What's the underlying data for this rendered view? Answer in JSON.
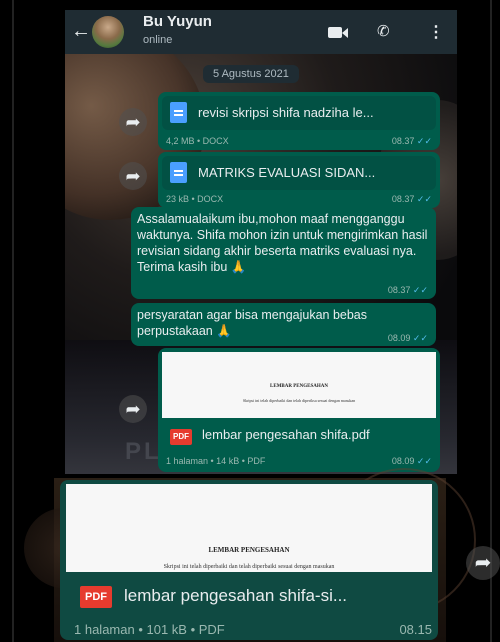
{
  "header": {
    "contact_name": "Bu Yuyun",
    "status": "online",
    "back_glyph": "←",
    "call_glyph": "✆",
    "menu_glyph": "⋮"
  },
  "date_separator": "5 Agustus 2021",
  "messages": [
    {
      "type": "document",
      "filename": "revisi skripsi shifa nadziha le...",
      "meta": "4,2 MB • DOCX",
      "time": "08.37",
      "ticks": "✓✓"
    },
    {
      "type": "document",
      "filename": "MATRIKS EVALUASI SIDAN...",
      "meta": "23 kB • DOCX",
      "time": "08.37",
      "ticks": "✓✓"
    },
    {
      "type": "text",
      "text": "Assalamualaikum ibu,mohon maaf mengganggu waktunya. Shifa mohon izin untuk mengirimkan hasil revisian sidang akhir beserta matriks evaluasi nya. Terima kasih ibu 🙏",
      "time": "08.37",
      "ticks": "✓✓"
    },
    {
      "type": "text",
      "text": "persyaratan agar bisa mengajukan bebas perpustakaan 🙏",
      "time": "08.09",
      "ticks": "✓✓"
    },
    {
      "type": "pdf",
      "preview_title": "LEMBAR PENGESAHAN",
      "preview_text": "Skripsi ini telah diperbaiki dan telah diperiksa sesuai dengan masukan",
      "badge": "PDF",
      "filename": "lembar pengesahan shifa.pdf",
      "meta": "1 halaman • 14 kB • PDF",
      "time": "08.09",
      "ticks": "✓✓"
    }
  ],
  "background_text": "PL",
  "bottom_message": {
    "preview_title": "LEMBAR PENGESAHAN",
    "preview_text": "Skripsi ini telah diperbaiki dan telah diperbaiki sesuai dengan masukan",
    "badge": "PDF",
    "filename": "lembar pengesahan shifa-si...",
    "meta": "1 halaman • 101 kB • PDF",
    "time": "08.15"
  },
  "colors": {
    "header_bg": "#1f2c33",
    "outgoing_bubble": "#005c4b",
    "read_ticks": "#53bdeb",
    "pdf_badge": "#e63b2e",
    "doc_icon": "#4a9fff"
  },
  "icons": [
    "back-arrow-icon",
    "video-call-icon",
    "phone-icon",
    "menu-icon",
    "forward-icon",
    "document-icon",
    "pdf-icon",
    "pray-emoji-icon"
  ]
}
